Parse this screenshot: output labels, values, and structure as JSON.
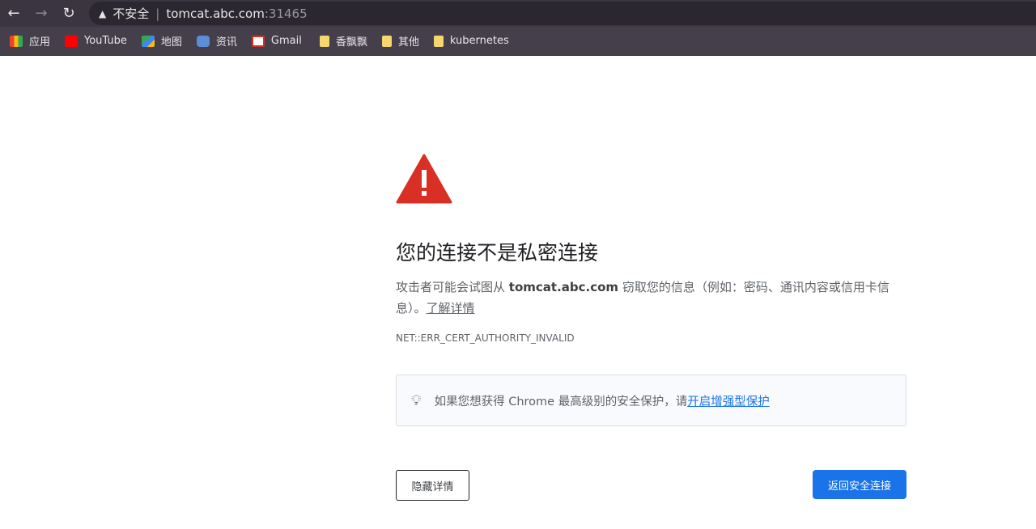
{
  "browser": {
    "security_label": "不安全",
    "url_host": "tomcat.abc.com",
    "url_port": ":31465",
    "bookmarks": [
      {
        "label": "应用",
        "icon": "apps-grid-icon"
      },
      {
        "label": "YouTube",
        "icon": "youtube-icon"
      },
      {
        "label": "地图",
        "icon": "maps-icon"
      },
      {
        "label": "资讯",
        "icon": "news-icon"
      },
      {
        "label": "Gmail",
        "icon": "gmail-icon"
      },
      {
        "label": "香飘飘",
        "icon": "folder-icon"
      },
      {
        "label": "其他",
        "icon": "folder-icon"
      },
      {
        "label": "kubernetes",
        "icon": "folder-icon"
      }
    ]
  },
  "page": {
    "title": "您的连接不是私密连接",
    "desc_prefix": "攻击者可能会试图从 ",
    "desc_host": "tomcat.abc.com",
    "desc_suffix": " 窃取您的信息（例如：密码、通讯内容或信用卡信息）。",
    "learn_more": "了解详情",
    "error_code": "NET::ERR_CERT_AUTHORITY_INVALID",
    "tip_text": "如果您想获得 Chrome 最高级别的安全保护，请",
    "tip_link": "开启增强型保护",
    "hide_details": "隐藏详情",
    "back_to_safety": "返回安全连接",
    "accent": "#1a73e8",
    "warning_color": "#d93025"
  }
}
